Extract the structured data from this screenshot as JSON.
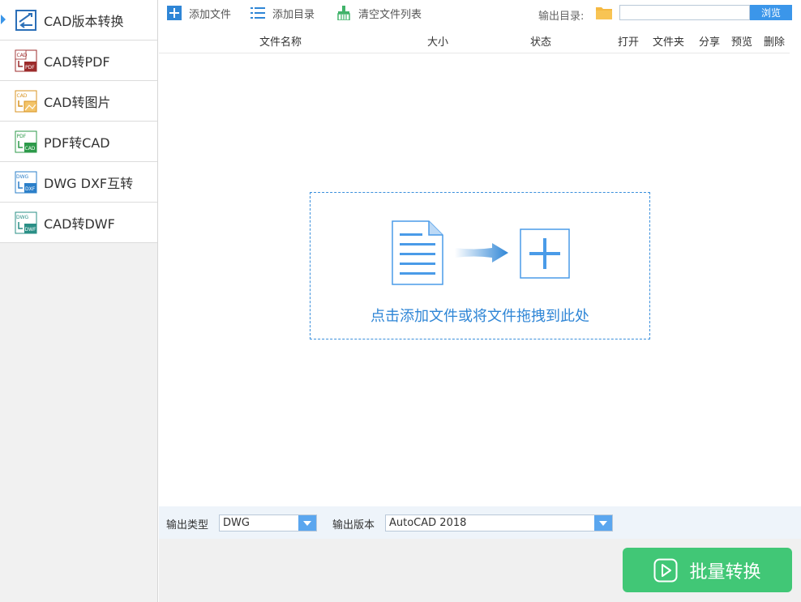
{
  "sidebar": {
    "items": [
      {
        "label": "CAD版本转换",
        "icon": "cad-version-icon",
        "active": true
      },
      {
        "label": "CAD转PDF",
        "icon": "cad-to-pdf-icon"
      },
      {
        "label": "CAD转图片",
        "icon": "cad-to-image-icon"
      },
      {
        "label": "PDF转CAD",
        "icon": "pdf-to-cad-icon"
      },
      {
        "label": "DWG DXF互转",
        "icon": "dwg-dxf-icon"
      },
      {
        "label": "CAD转DWF",
        "icon": "cad-to-dwf-icon"
      }
    ]
  },
  "toolbar": {
    "add_file": "添加文件",
    "add_dir": "添加目录",
    "clear_list": "清空文件列表",
    "output_dir_label": "输出目录:",
    "output_dir_value": "",
    "browse": "浏览"
  },
  "table": {
    "columns": [
      "文件名称",
      "大小",
      "状态",
      "打开",
      "文件夹",
      "分享",
      "预览",
      "删除"
    ]
  },
  "dropzone": {
    "text": "点击添加文件或将文件拖拽到此处"
  },
  "options": {
    "output_type_label": "输出类型",
    "output_type_value": "DWG",
    "output_version_label": "输出版本",
    "output_version_value": "AutoCAD 2018"
  },
  "footer": {
    "convert": "批量转换"
  },
  "colors": {
    "accent": "#3b96ea",
    "convert_green": "#41c776",
    "dropzone_text": "#2f86d6"
  }
}
